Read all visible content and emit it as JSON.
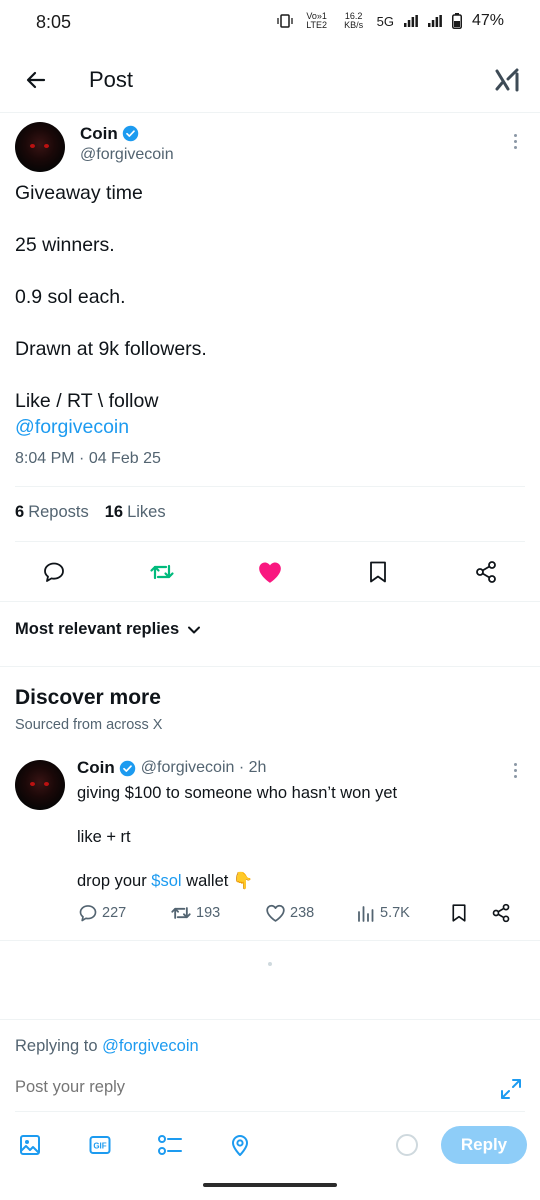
{
  "status_bar": {
    "time": "8:05",
    "volte": "Vo»1 LTE2",
    "speed": "16.2 KB/s",
    "network": "5G",
    "battery": "47%"
  },
  "header": {
    "title": "Post"
  },
  "post": {
    "author_name": "Coin",
    "author_handle": "@forgivecoin",
    "lines": [
      "Giveaway time",
      "25 winners.",
      "0.9 sol each.",
      "Drawn at 9k followers.",
      "Like / RT \\ follow"
    ],
    "mention": "@forgivecoin",
    "time": "8:04 PM",
    "date": "04 Feb 25",
    "reposts_count": "6",
    "reposts_label": "Reposts",
    "likes_count": "16",
    "likes_label": "Likes",
    "liked": true,
    "reposted": true
  },
  "replies_sort": {
    "label": "Most relevant replies"
  },
  "discover": {
    "title": "Discover more",
    "subtitle": "Sourced from across X",
    "item": {
      "author_name": "Coin",
      "author_handle": "@forgivecoin",
      "age": "2h",
      "line1": "giving $100 to someone who hasn’t won yet",
      "line2": "like + rt",
      "line3_prefix": "drop your ",
      "cashtag": "$sol",
      "line3_suffix": " wallet 👇",
      "replies": "227",
      "reposts": "193",
      "likes": "238",
      "views": "5.7K"
    }
  },
  "composer": {
    "replying_prefix": "Replying to ",
    "replying_handle": "@forgivecoin",
    "placeholder": "Post your reply",
    "gif_label": "GIF",
    "reply_button": "Reply"
  },
  "colors": {
    "accent": "#1d9bf0",
    "repost_active": "#00ba7c",
    "like_active": "#f91880",
    "secondary_text": "#536471",
    "reply_button_disabled": "#8ecdf8"
  }
}
